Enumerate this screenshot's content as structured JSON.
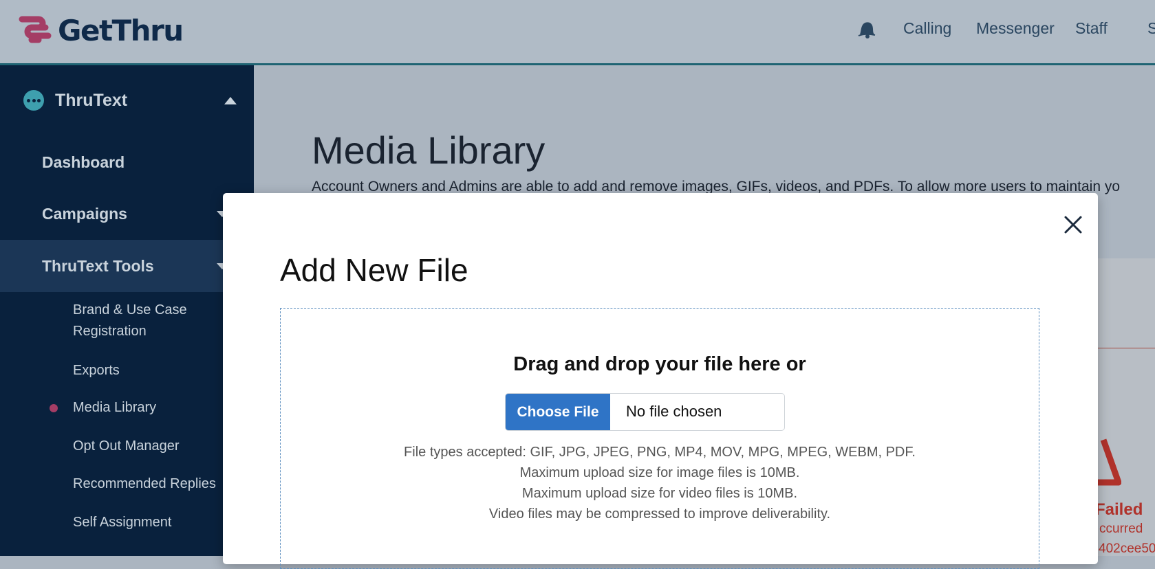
{
  "header": {
    "brand": "GetThru",
    "nav": [
      "Calling",
      "Messenger",
      "Staff",
      "S"
    ]
  },
  "sidebar": {
    "section_title": "ThruText",
    "items": [
      "Dashboard",
      "Campaigns",
      "ThruText Tools"
    ],
    "sub_items": [
      "Brand & Use Case",
      "Registration",
      "Exports",
      "Media Library",
      "Opt Out Manager",
      "Recommended Replies",
      "Self Assignment"
    ]
  },
  "main": {
    "title": "Media Library",
    "description": "Account Owners and Admins are able to add and remove images, GIFs, videos, and PDFs. To allow more users to maintain yo",
    "status_failed": "Failed",
    "status_detail": "ccurred",
    "status_id": "402cee50"
  },
  "modal": {
    "title": "Add New File",
    "drop_heading": "Drag and drop your file here or",
    "choose_label": "Choose File",
    "file_status": "No file chosen",
    "info_lines": [
      "File types accepted: GIF, JPG, JPEG, PNG, MP4, MOV, MPG, MPEG, WEBM, PDF.",
      "Maximum upload size for image files is 10MB.",
      "Maximum upload size for video files is 10MB.",
      "Video files may be compressed to improve deliverability."
    ]
  },
  "colors": {
    "sidebar_bg": "#09213d",
    "accent_teal": "#1f6473",
    "choose_button": "#2f74c6",
    "error_red": "#b0322b",
    "active_dot": "#a43d65"
  }
}
